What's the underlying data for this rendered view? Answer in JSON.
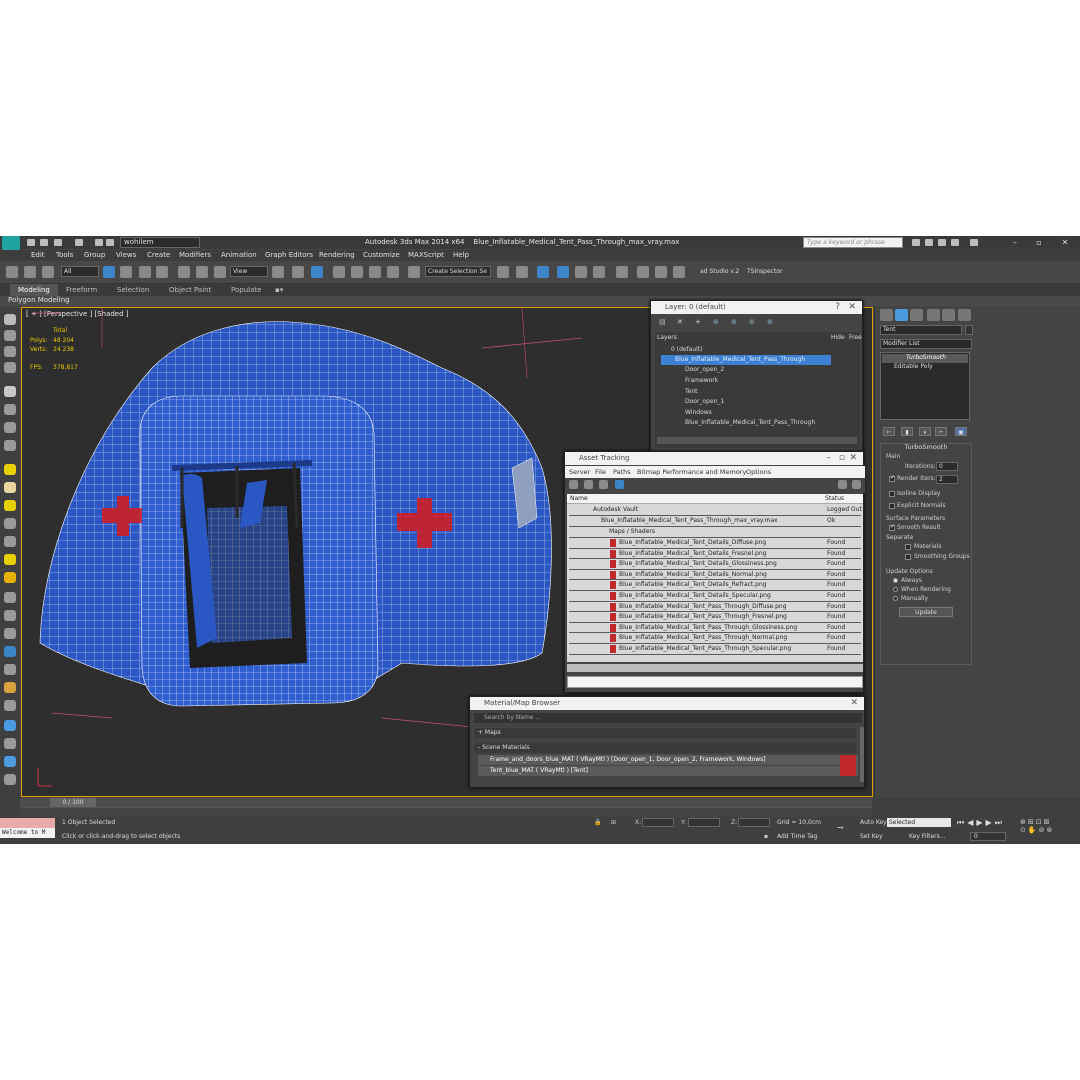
{
  "window": {
    "app_title": "Autodesk 3ds Max  2014 x64",
    "file_title": "Blue_Inflatable_Medical_Tent_Pass_Through_max_vray.max",
    "workspace": "wohilem",
    "search_placeholder": "Type a keyword or phrase"
  },
  "menu": [
    "Edit",
    "Tools",
    "Group",
    "Views",
    "Create",
    "Modifiers",
    "Animation",
    "Graph Editors",
    "Rendering",
    "Customize",
    "MAXScript",
    "Help"
  ],
  "toolbar": {
    "selection_filter": "All",
    "reference_coord": "View",
    "named_selection": "Create Selection Se",
    "plugin1": "ad Studio v.2",
    "plugin2": "TSInspector"
  },
  "ribbon": {
    "tabs": [
      "Modeling",
      "Freeform",
      "Selection",
      "Object Paint",
      "Populate"
    ],
    "subtab": "Polygon Modeling"
  },
  "viewport": {
    "label": "[ + ] [Perspective ] [Shaded ]",
    "stats": {
      "total_label": "Total",
      "polys_label": "Polys:",
      "polys_value": "48 204",
      "verts_label": "Verts:",
      "verts_value": "24 238",
      "fps_label": "FPS:",
      "fps_value": "378,817"
    },
    "colors": {
      "tent": "#2a57c4",
      "cross": "#cc1f26",
      "wire": "#ffffff",
      "background": "#2e2e2e"
    }
  },
  "layer_dialog": {
    "title": "Layer: 0 (default)",
    "header_layers": "Layers",
    "header_hide": "Hide",
    "header_freeze": "Free",
    "rows": [
      "0 (default)",
      "Blue_Inflatable_Medical_Tent_Pass_Through",
      "Door_open_2",
      "Framework",
      "Tent",
      "Door_open_1",
      "Windows",
      "Blue_Inflatable_Medical_Tent_Pass_Through"
    ]
  },
  "asset_tracking": {
    "title": "Asset Tracking",
    "menu": [
      "Server",
      "File",
      "Paths",
      "Bitmap Performance and Memory",
      "Options"
    ],
    "col_name": "Name",
    "col_status": "Status",
    "vault": "Autodesk Vault",
    "vault_status": "Logged Out",
    "file": "Blue_Inflatable_Medical_Tent_Pass_Through_max_vray.max",
    "file_status": "Ok",
    "maps_label": "Maps / Shaders",
    "found": "Found",
    "maps": [
      "Blue_Inflatable_Medical_Tent_Details_Diffuse.png",
      "Blue_Inflatable_Medical_Tent_Details_Fresnel.png",
      "Blue_Inflatable_Medical_Tent_Details_Glossiness.png",
      "Blue_Inflatable_Medical_Tent_Details_Normal.png",
      "Blue_Inflatable_Medical_Tent_Details_Refract.png",
      "Blue_Inflatable_Medical_Tent_Details_Specular.png",
      "Blue_Inflatable_Medical_Tent_Pass_Through_Diffuse.png",
      "Blue_Inflatable_Medical_Tent_Pass_Through_Fresnel.png",
      "Blue_Inflatable_Medical_Tent_Pass_Through_Glossiness.png",
      "Blue_Inflatable_Medical_Tent_Pass_Through_Normal.png",
      "Blue_Inflatable_Medical_Tent_Pass_Through_Specular.png"
    ]
  },
  "material_browser": {
    "title": "Material/Map Browser",
    "search_placeholder": "Search by Name ...",
    "maps_group": "+ Maps",
    "scene_group": "- Scene Materials",
    "materials": [
      "Frame_and_doors_blue_MAT  ( VRayMtl )  [Door_open_1, Door_open_2, Framework, Windows]",
      "Tent_blue_MAT  ( VRayMtl )  [Tent]"
    ]
  },
  "command_panel": {
    "object_name": "Tent",
    "modifier_list": "Modifier List",
    "stack": [
      "TurboSmooth",
      "Editable Poly"
    ],
    "turbosmooth": {
      "title": "TurboSmooth",
      "main": "Main",
      "iterations_label": "Iterations:",
      "iterations_value": "0",
      "render_iters_label": "Render Iters:",
      "render_iters_value": "2",
      "isoline": "Isoline Display",
      "explicit_normals": "Explicit Normals",
      "surface_params": "Surface Parameters",
      "smooth_result": "Smooth Result",
      "separate": "Separate",
      "materials": "Materials",
      "smoothing_groups": "Smoothing Groups",
      "update_options": "Update Options",
      "always": "Always",
      "when_rendering": "When Rendering",
      "manually": "Manually",
      "update_button": "Update"
    }
  },
  "status": {
    "frame": "0 / 100",
    "maxscript": "Welcome to M",
    "selected": "1 Object Selected",
    "prompt": "Click or click-and-drag to select objects",
    "x_label": "X:",
    "y_label": "Y:",
    "z_label": "Z:",
    "grid": "Grid = 10,0cm",
    "add_time_tag": "Add Time Tag",
    "auto_key": "Auto Key",
    "set_key": "Set Key",
    "selected_drop": "Selected",
    "key_filters": "Key Filters...",
    "frame_value": "0"
  }
}
